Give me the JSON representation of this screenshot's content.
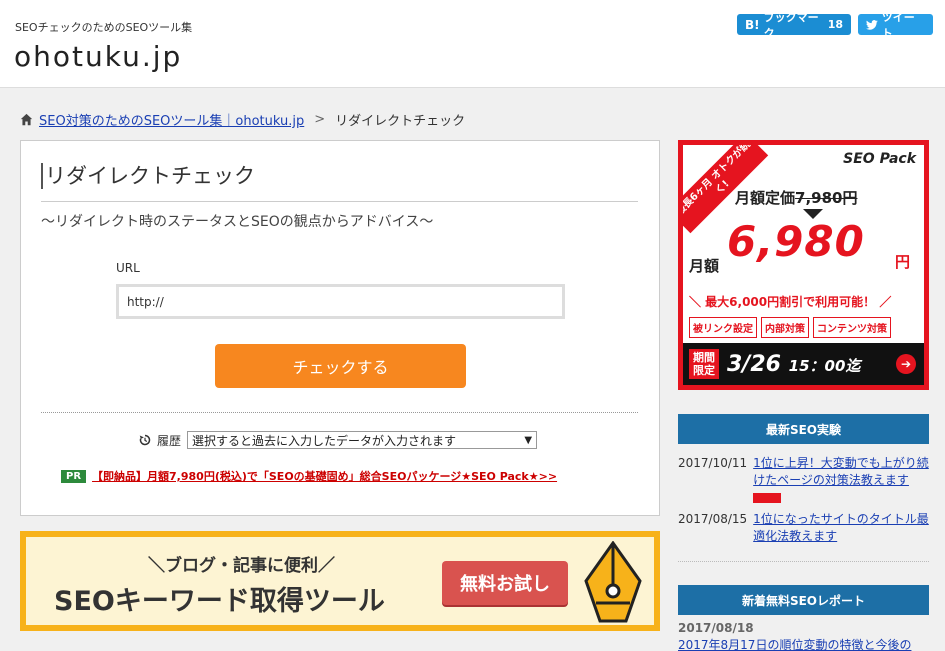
{
  "header": {
    "tagline": "SEOチェックのためのSEOツール集",
    "logo": "ohotuku.jp",
    "hatena_label": "ブックマーク",
    "hatena_mark": "B!",
    "hatena_count": "18",
    "tweet_label": "ツイート"
  },
  "breadcrumb": {
    "home_link": "SEO対策のためのSEOツール集｜ohotuku.jp",
    "separator": ">",
    "current": "リダイレクトチェック"
  },
  "main": {
    "title": "リダイレクトチェック",
    "subtitle": "～リダイレクト時のステータスとSEOの観点からアドバイス～",
    "url_label": "URL",
    "url_value": "http://",
    "check_button": "チェックする",
    "history_label": "履歴",
    "history_select": "選択すると過去に入力したデータが入力されます",
    "pr_badge": "PR",
    "pr_link": "【即納品】月額7,980円(税込)で「SEOの基礎固め」総合SEOパッケージ★SEO Pack★>>"
  },
  "banner": {
    "sub": "＼ブログ・記事に便利／",
    "main": "SEOキーワード取得ツール",
    "button": "無料お試し"
  },
  "side_ad": {
    "ribbon": "最長6ヶ月 オトクが続く!",
    "brand": "SEO Pack",
    "regular_prefix": "月額定価",
    "regular_price": "7,980円",
    "monthly": "月額",
    "price": "6,980",
    "yen": "円",
    "discount": "＼ 最大6,000円割引で利用可能！ ／",
    "tags": [
      "被リンク設定",
      "内部対策",
      "コンテンツ対策"
    ],
    "limited": "期間限定",
    "deadline_date": "3/26",
    "deadline_time": "15：00迄"
  },
  "sidebar": {
    "latest_title": "最新SEO実験",
    "latest": [
      {
        "date": "2017/10/11",
        "title": "1位に上昇！大変動でも上がり続けたページの対策法教えます"
      },
      {
        "date": "2017/08/15",
        "title": "1位になったサイトのタイトル最適化法教えます"
      }
    ],
    "reports_title": "新着無料SEOレポート",
    "report_date": "2017/08/18",
    "report_title": "2017年8月17日の順位変動の特徴と今後の"
  }
}
